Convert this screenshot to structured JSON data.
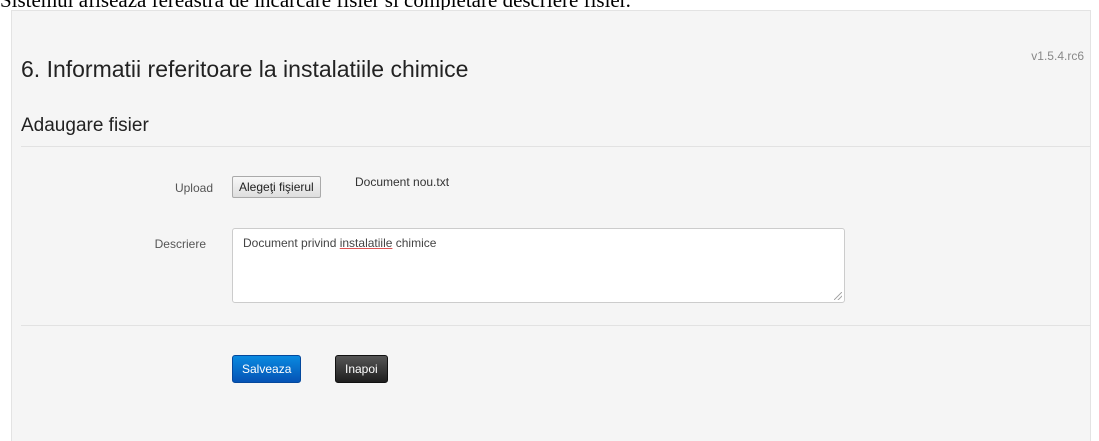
{
  "caption": "Sistemul afiseaza fereastra de incarcare fisier si completare descriere fisier.",
  "version": "v1.5.4.rc6",
  "page_title": "6. Informatii referitoare la instalatiile chimice",
  "section_title": "Adaugare fisier",
  "form": {
    "upload_label": "Upload",
    "upload_button_label": "Alegeţi fişierul",
    "upload_file_name": "Document nou.txt",
    "description_label": "Descriere",
    "description_value": {
      "before": "Document privind ",
      "misspelled": "instalatiile",
      "after": " chimice"
    }
  },
  "actions": {
    "save_label": "Salveaza",
    "back_label": "Inapoi"
  },
  "colors": {
    "save_button": "#0a6fd0",
    "back_button": "#333333",
    "panel_background": "#f5f5f5"
  }
}
